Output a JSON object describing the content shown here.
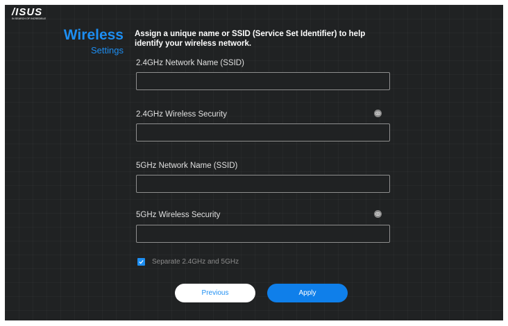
{
  "header": {
    "brand": "/ISUS",
    "tagline": "IN SEARCH OF INCREDIBLE"
  },
  "page": {
    "title": "Wireless",
    "subtitle": "Settings",
    "instruction": "Assign a unique name or SSID (Service Set Identifier) to help identify your wireless network."
  },
  "form": {
    "ssid_24_label": "2.4GHz Network Name (SSID)",
    "ssid_24_value": "",
    "security_24_label": "2.4GHz Wireless Security",
    "security_24_value": "",
    "ssid_5_label": "5GHz Network Name (SSID)",
    "ssid_5_value": "",
    "security_5_label": "5GHz Wireless Security",
    "security_5_value": "",
    "separate_label": "Separate 2.4GHz and 5GHz",
    "separate_checked": true,
    "password_toggle_icon": "eye-icon"
  },
  "buttons": {
    "previous": "Previous",
    "apply": "Apply"
  },
  "colors": {
    "accent": "#1d8ef2",
    "background": "#202223",
    "button_primary": "#0f7fea"
  }
}
